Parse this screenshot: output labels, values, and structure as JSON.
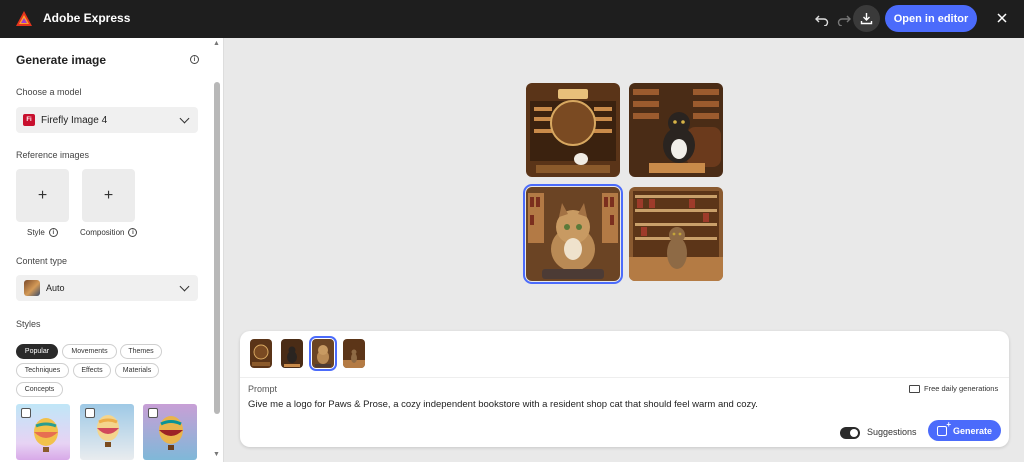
{
  "app": {
    "title": "Adobe Express",
    "brand_color": "#e5341d"
  },
  "topbar": {
    "undo_icon": "undo-icon",
    "redo_icon": "redo-icon",
    "download_icon": "download-icon",
    "open_editor_label": "Open in editor",
    "close_icon": "close-icon"
  },
  "sidebar": {
    "title": "Generate image",
    "model_label": "Choose a model",
    "model_value": "Firefly Image 4",
    "model_badge": "Fi",
    "reference_label": "Reference images",
    "reference_boxes": [
      {
        "label": "Style",
        "plus": "+"
      },
      {
        "label": "Composition",
        "plus": "+"
      }
    ],
    "content_type_label": "Content type",
    "content_type_value": "Auto",
    "styles_label": "Styles",
    "style_chips": [
      "Popular",
      "Movements",
      "Themes",
      "Techniques",
      "Effects",
      "Materials",
      "Concepts"
    ],
    "active_chip": "Popular"
  },
  "gallery": {
    "selected_index": 2,
    "images": [
      "bookstore-shop-sign",
      "cat-in-library-armchair",
      "tabby-cat-portrait",
      "cat-sitting-bookstore-floor"
    ]
  },
  "prompt_panel": {
    "prompt_label": "Prompt",
    "free_generations": "Free daily generations",
    "prompt_text": "Give me a logo for Paws & Prose, a cozy independent bookstore with a resident shop cat that should feel warm and cozy.",
    "suggestions_label": "Suggestions",
    "suggestions_on": true,
    "generate_label": "Generate",
    "selected_thumb": 2
  },
  "colors": {
    "accent": "#4b6bfb",
    "topbar": "#1e1e1e"
  }
}
